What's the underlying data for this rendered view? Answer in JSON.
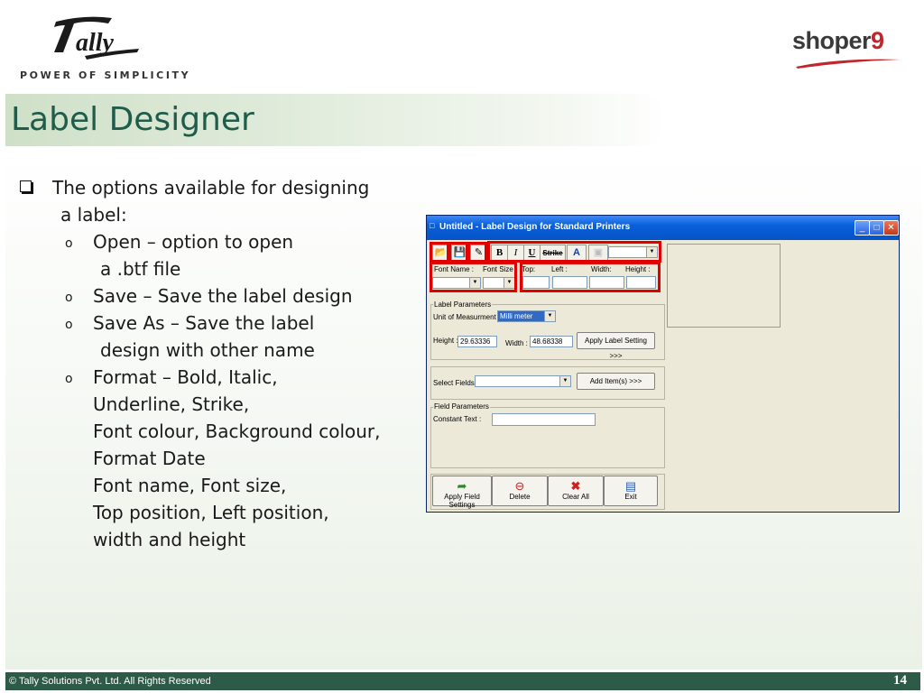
{
  "header": {
    "logo_text": "Tally",
    "tagline": "POWER OF SIMPLICITY",
    "brand_right": "shoper",
    "brand_right_number": "9",
    "slide_title": "Label Designer"
  },
  "content": {
    "intro_line1": "The options available for designing",
    "intro_line2": "a label:",
    "open_line1": "Open – option to open",
    "open_line2": "a .btf file",
    "save_line": "Save – Save the label design",
    "saveas_line1": "Save As – Save the label",
    "saveas_line2": "design with other name",
    "format_line1": "Format – Bold, Italic,",
    "format_line2": "Underline, Strike,",
    "format_line3": "Font colour, Background colour,",
    "format_line4": "Format Date",
    "format_line5": "Font name, Font size,",
    "format_line6": "Top position, Left position,",
    "format_line7": "width and height",
    "bullet_char": "o"
  },
  "window": {
    "title": "Untitled - Label Design for Standard Printers",
    "toolbar": {
      "bold_label": "B",
      "italic_label": "I",
      "underline_label": "U",
      "strike_label": "Strike",
      "font_color_label": "A"
    },
    "format_row": {
      "font_name_label": "Font Name :",
      "font_size_label": "Font Size :",
      "top_label": "Top:",
      "left_label": "Left :",
      "width_label": "Width:",
      "height_label": "Height :"
    },
    "label_parameters": {
      "group_title": "Label Parameters",
      "unit_label": "Unit of Measurment :",
      "unit_value": "Milli meter",
      "height_label": "Height :",
      "height_value": "29.63336",
      "width_label": "Width :",
      "width_value": "48.68338",
      "apply_button": "Apply Label Setting >>>"
    },
    "select_fields": {
      "label": "Select Fields:",
      "add_button": "Add Item(s) >>>"
    },
    "field_parameters": {
      "group_title": "Field Parameters",
      "constant_text_label": "Constant Text :"
    },
    "bottom_buttons": {
      "apply_field": "Apply Field Settings",
      "delete": "Delete",
      "clear_all": "Clear All",
      "exit": "Exit"
    }
  },
  "footer": {
    "copyright": "© Tally Solutions Pvt. Ltd. All Rights Reserved",
    "page_number": "14"
  },
  "colors": {
    "title_green": "#1f5c49",
    "footer_green": "#2e5b47",
    "highlight_red": "#e00000",
    "xp_blue": "#0a5fd8",
    "brand_red": "#c0272d"
  }
}
